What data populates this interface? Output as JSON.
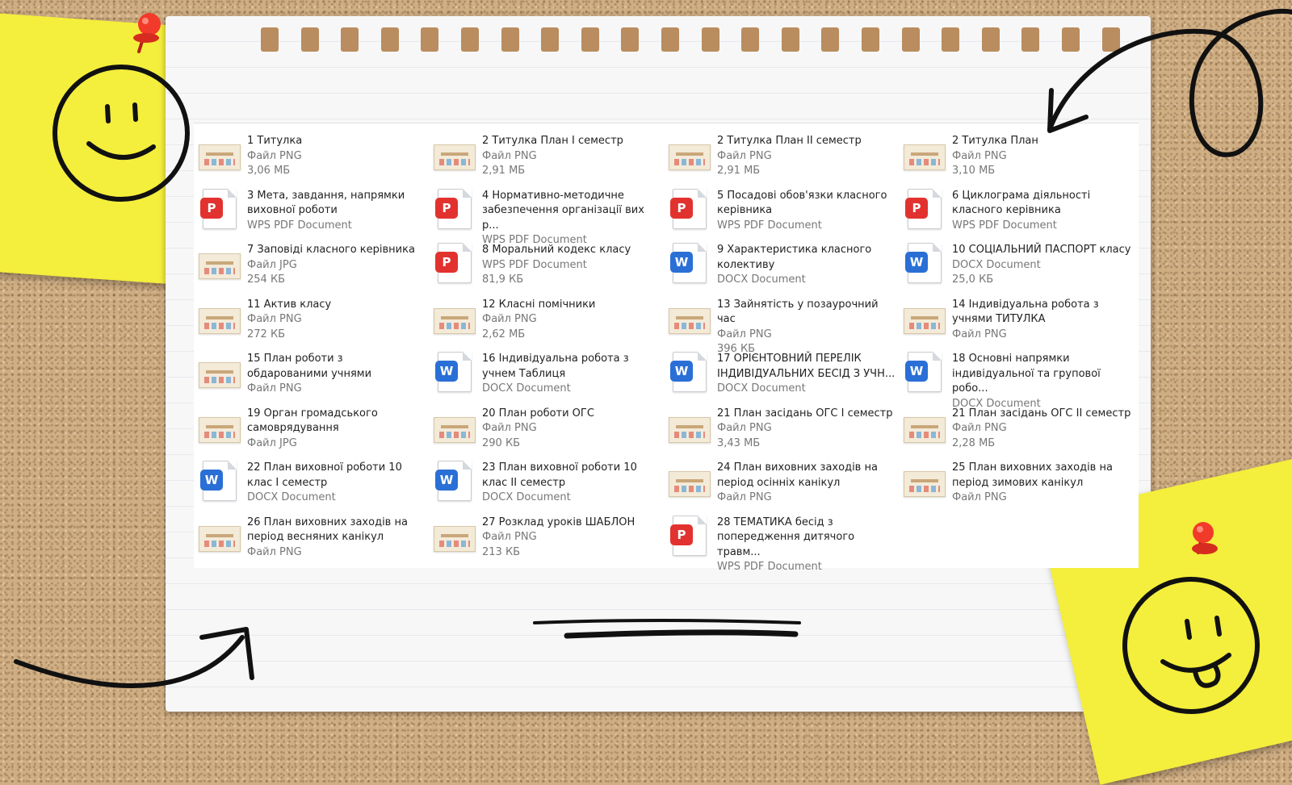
{
  "colors": {
    "cork": "#cfae84",
    "sticky_note": "#f4ee3c",
    "pin": "#f23a2b",
    "pdf_icon": "#e2322f",
    "word_icon": "#2a6fd6",
    "name_text": "#222222",
    "meta_text": "#777777"
  },
  "files": [
    {
      "name": "1 Титулка",
      "type": "Файл PNG",
      "size": "3,06 МБ",
      "icon": "image-thumbnail-icon"
    },
    {
      "name": "2 Титулка План І семестр",
      "type": "Файл PNG",
      "size": "2,91 МБ",
      "icon": "image-thumbnail-icon"
    },
    {
      "name": "2 Титулка План ІІ семестр",
      "type": "Файл PNG",
      "size": "2,91 МБ",
      "icon": "image-thumbnail-icon"
    },
    {
      "name": "2 Титулка План",
      "type": "Файл PNG",
      "size": "3,10 МБ",
      "icon": "image-thumbnail-icon"
    },
    {
      "name": "3 Мета, завдання, напрямки виховної роботи",
      "type": "WPS PDF Document",
      "size": "",
      "icon": "pdf-icon"
    },
    {
      "name": "4 Нормативно-методичне забезпечення організації вих р...",
      "type": "WPS PDF Document",
      "size": "",
      "icon": "pdf-icon"
    },
    {
      "name": "5 Посадові обов'язки класного керівника",
      "type": "WPS PDF Document",
      "size": "",
      "icon": "pdf-icon"
    },
    {
      "name": "6 Циклограма діяльності класного керівника",
      "type": "WPS PDF Document",
      "size": "",
      "icon": "pdf-icon"
    },
    {
      "name": "7 Заповіді класного керівника",
      "type": "Файл JPG",
      "size": "254 КБ",
      "icon": "image-thumbnail-icon"
    },
    {
      "name": "8 Моральний кодекс класу",
      "type": "WPS PDF Document",
      "size": "81,9 КБ",
      "icon": "pdf-icon"
    },
    {
      "name": "9 Характеристика класного колективу",
      "type": "DOCX Document",
      "size": "",
      "icon": "word-icon"
    },
    {
      "name": "10 СОЦІАЛЬНИЙ ПАСПОРТ класу",
      "type": "DOCX Document",
      "size": "25,0 КБ",
      "icon": "word-icon"
    },
    {
      "name": "11 Актив класу",
      "type": "Файл PNG",
      "size": "272 КБ",
      "icon": "image-thumbnail-icon"
    },
    {
      "name": "12 Класні помічники",
      "type": "Файл PNG",
      "size": "2,62 МБ",
      "icon": "image-thumbnail-icon"
    },
    {
      "name": "13 Зайнятість у позаурочний час",
      "type": "Файл PNG",
      "size": "396 КБ",
      "icon": "image-thumbnail-icon"
    },
    {
      "name": "14 Індивідуальна робота з учнями ТИТУЛКА",
      "type": "Файл PNG",
      "size": "",
      "icon": "image-thumbnail-icon"
    },
    {
      "name": "15 План роботи з обдарованими учнями",
      "type": "Файл PNG",
      "size": "",
      "icon": "image-thumbnail-icon"
    },
    {
      "name": "16 Індивідуальна робота з учнем Таблиця",
      "type": "DOCX Document",
      "size": "",
      "icon": "word-icon"
    },
    {
      "name": "17 ОРІЄНТОВНИЙ ПЕРЕЛІК ІНДИВІДУАЛЬНИХ БЕСІД З УЧН...",
      "type": "DOCX Document",
      "size": "",
      "icon": "word-icon"
    },
    {
      "name": "18 Основні напрямки індивідуальної та групової робо...",
      "type": "DOCX Document",
      "size": "",
      "icon": "word-icon"
    },
    {
      "name": "19 Орган громадського самоврядування",
      "type": "Файл JPG",
      "size": "",
      "icon": "image-thumbnail-icon"
    },
    {
      "name": "20 План роботи ОГС",
      "type": "Файл PNG",
      "size": "290 КБ",
      "icon": "image-thumbnail-icon"
    },
    {
      "name": "21 План засідань ОГС І семестр",
      "type": "Файл PNG",
      "size": "3,43 МБ",
      "icon": "image-thumbnail-icon"
    },
    {
      "name": "21 План засідань ОГС ІІ семестр",
      "type": "Файл PNG",
      "size": "2,28 МБ",
      "icon": "image-thumbnail-icon"
    },
    {
      "name": "22 План виховної роботи 10 клас І семестр",
      "type": "DOCX Document",
      "size": "",
      "icon": "word-icon"
    },
    {
      "name": "23 План виховної роботи 10 клас ІІ семестр",
      "type": "DOCX Document",
      "size": "",
      "icon": "word-icon"
    },
    {
      "name": "24 План виховних заходів на період осінніх канікул",
      "type": "Файл PNG",
      "size": "",
      "icon": "image-thumbnail-icon"
    },
    {
      "name": "25 План виховних заходів на період зимових канікул",
      "type": "Файл PNG",
      "size": "",
      "icon": "image-thumbnail-icon"
    },
    {
      "name": "26 План виховних заходів на період весняних канікул",
      "type": "Файл PNG",
      "size": "",
      "icon": "image-thumbnail-icon"
    },
    {
      "name": "27 Розклад уроків ШАБЛОН",
      "type": "Файл PNG",
      "size": "213 КБ",
      "icon": "image-thumbnail-icon"
    },
    {
      "name": "28 ТЕМАТИКА бесід з попередження дитячого травм...",
      "type": "WPS PDF Document",
      "size": "",
      "icon": "pdf-icon"
    }
  ]
}
